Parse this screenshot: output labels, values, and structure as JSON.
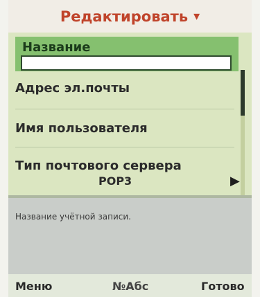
{
  "title": "Редактировать",
  "title_dropdown": "▾",
  "fields": [
    {
      "label": "Название",
      "value": ""
    },
    {
      "label": "Адрес эл.почты"
    },
    {
      "label": "Имя пользователя"
    },
    {
      "label": "Тип почтового сервера",
      "value": "POP3"
    }
  ],
  "help_text": "Название учётной записи.",
  "softkeys": {
    "left": "Меню",
    "middle": "№Абс",
    "right": "Готово"
  },
  "colors": {
    "title": "#c0442b",
    "selection": "#85c06f",
    "background": "#dbe6c1"
  },
  "icons": {
    "right_arrow": "right-arrow-icon",
    "scrollbar": "scrollbar"
  }
}
